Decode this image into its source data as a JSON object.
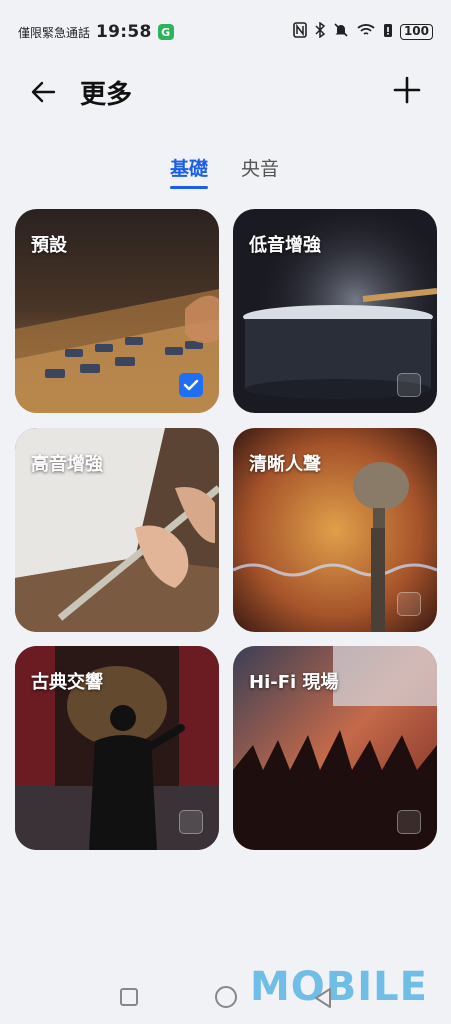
{
  "status_bar": {
    "carrier": "僅限緊急通話",
    "time": "19:58",
    "app_badge": "G",
    "icons": [
      "nfc-icon",
      "bluetooth-icon",
      "mute-icon",
      "wifi-icon",
      "battery-alert-icon"
    ],
    "battery": "100"
  },
  "header": {
    "title": "更多",
    "back_icon": "arrow-left-icon",
    "add_icon": "plus-icon"
  },
  "tabs": [
    {
      "label": "基礎",
      "active": true
    },
    {
      "label": "央音",
      "active": false
    }
  ],
  "cards": [
    {
      "label": "預設",
      "checked": true
    },
    {
      "label": "低音增強",
      "checked": false
    },
    {
      "label": "高音增強",
      "checked": false
    },
    {
      "label": "清晰人聲",
      "checked": false
    },
    {
      "label": "古典交響",
      "checked": false
    },
    {
      "label": "Hi-Fi 現場",
      "checked": false
    }
  ],
  "watermark": "MOBILE",
  "colors": {
    "accent": "#1b5ee8",
    "background": "#f1f2f6"
  }
}
